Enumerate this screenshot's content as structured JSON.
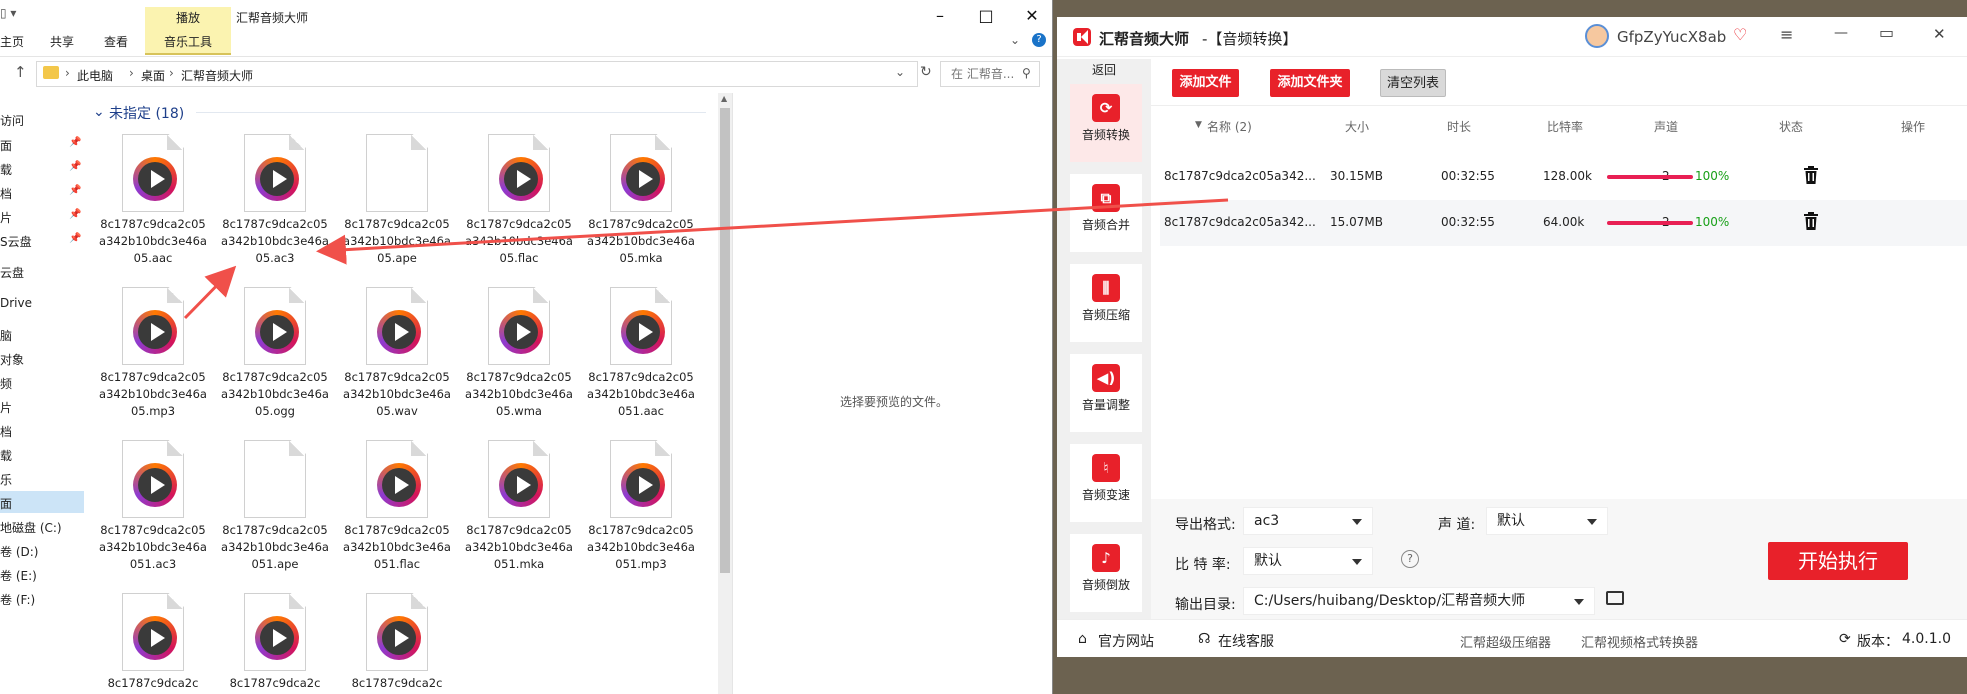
{
  "explorer": {
    "title": "汇帮音频大师",
    "context_tab_header": "播放",
    "tabs": [
      "主页",
      "共享",
      "查看",
      "音乐工具"
    ],
    "breadcrumb": [
      "此电脑",
      "桌面",
      "汇帮音频大师"
    ],
    "search_placeholder": "在 汇帮音...",
    "group_header": "未指定 (18)",
    "preview_text": "选择要预览的文件。",
    "nav_items": [
      "访问",
      "面",
      "载",
      "档",
      "片",
      "S云盘",
      "云盘",
      "Drive",
      "脑",
      "对象",
      "频",
      "片",
      "档",
      "载",
      "乐",
      "面",
      "地磁盘 (C:)",
      "卷 (D:)",
      "卷 (E:)",
      "卷 (F:)"
    ],
    "files": [
      {
        "name": "8c1787c9dca2c05a342b10bdc3e46a05.aac",
        "type": "audio"
      },
      {
        "name": "8c1787c9dca2c05a342b10bdc3e46a05.ac3",
        "type": "audio"
      },
      {
        "name": "8c1787c9dca2c05a342b10bdc3e46a05.ape",
        "type": "blank"
      },
      {
        "name": "8c1787c9dca2c05a342b10bdc3e46a05.flac",
        "type": "audio"
      },
      {
        "name": "8c1787c9dca2c05a342b10bdc3e46a05.mka",
        "type": "audio"
      },
      {
        "name": "8c1787c9dca2c05a342b10bdc3e46a05.mp3",
        "type": "audio"
      },
      {
        "name": "8c1787c9dca2c05a342b10bdc3e46a05.ogg",
        "type": "audio"
      },
      {
        "name": "8c1787c9dca2c05a342b10bdc3e46a05.wav",
        "type": "audio"
      },
      {
        "name": "8c1787c9dca2c05a342b10bdc3e46a05.wma",
        "type": "audio"
      },
      {
        "name": "8c1787c9dca2c05a342b10bdc3e46a051.aac",
        "type": "audio"
      },
      {
        "name": "8c1787c9dca2c05a342b10bdc3e46a051.ac3",
        "type": "audio"
      },
      {
        "name": "8c1787c9dca2c05a342b10bdc3e46a051.ape",
        "type": "blank"
      },
      {
        "name": "8c1787c9dca2c05a342b10bdc3e46a051.flac",
        "type": "audio"
      },
      {
        "name": "8c1787c9dca2c05a342b10bdc3e46a051.mka",
        "type": "audio"
      },
      {
        "name": "8c1787c9dca2c05a342b10bdc3e46a051.mp3",
        "type": "audio"
      },
      {
        "name": "8c1787c9dca2c",
        "type": "audio"
      },
      {
        "name": "8c1787c9dca2c",
        "type": "audio"
      },
      {
        "name": "8c1787c9dca2c",
        "type": "audio"
      }
    ]
  },
  "app": {
    "title": "汇帮音频大师",
    "subtitle": "-【音频转换】",
    "username": "GfpZyYucX8ab",
    "back_label": "返回",
    "sidebar": [
      "音频转换",
      "音频合并",
      "音频压缩",
      "音量调整",
      "音频变速",
      "音频倒放"
    ],
    "buttons": {
      "add_file": "添加文件",
      "add_folder": "添加文件夹",
      "clear_list": "清空列表",
      "start": "开始执行"
    },
    "columns": {
      "name": "名称 (2)",
      "size": "大小",
      "duration": "时长",
      "bitrate": "比特率",
      "channels": "声道",
      "status": "状态",
      "action": "操作"
    },
    "rows": [
      {
        "name": "8c1787c9dca2c05a342...",
        "size": "30.15MB",
        "duration": "00:32:55",
        "bitrate": "128.00k",
        "channels": "2",
        "progress": "100%"
      },
      {
        "name": "8c1787c9dca2c05a342...",
        "size": "15.07MB",
        "duration": "00:32:55",
        "bitrate": "64.00k",
        "channels": "2",
        "progress": "100%"
      }
    ],
    "settings": {
      "format_label": "导出格式:",
      "format_value": "ac3",
      "channel_label": "声 道:",
      "channel_value": "默认",
      "bitrate_label": "比 特 率:",
      "bitrate_value": "默认",
      "help_glyph": "?",
      "output_label": "输出目录:",
      "output_value": "C:/Users/huibang/Desktop/汇帮音频大师"
    },
    "footer": {
      "website": "官方网站",
      "service": "在线客服",
      "link1": "汇帮超级压缩器",
      "link2": "汇帮视频格式转换器",
      "version_label": "版本：",
      "version": "4.0.1.0"
    },
    "colors": {
      "accent": "#e8212a",
      "progress": "#e82054",
      "pct_text": "#18a018"
    }
  }
}
